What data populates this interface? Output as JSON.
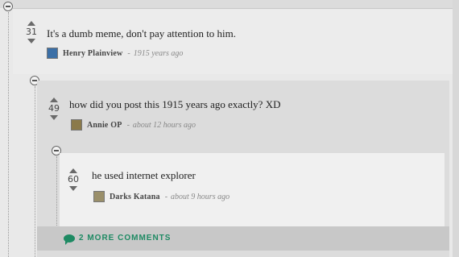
{
  "comments": [
    {
      "score": "31",
      "text": "It's a dumb meme, don't pay attention to him.",
      "author": "Henry Plainview",
      "separator": "-",
      "time": "1915 years ago",
      "avatar_color": "#3b6fa6"
    },
    {
      "score": "49",
      "text": "how did you post this 1915 years ago exactly? XD",
      "author": "Annie OP",
      "separator": "-",
      "time": "about 12 hours ago",
      "avatar_color": "#8b7a4a"
    },
    {
      "score": "60",
      "text": "he used internet explorer",
      "author": "Darks Katana",
      "separator": "-",
      "time": "about 9 hours ago",
      "avatar_color": "#9a8f6a"
    }
  ],
  "more_comments": {
    "label": "2 MORE COMMENTS",
    "icon": "speech-bubble-icon",
    "color": "#1e8a63"
  }
}
